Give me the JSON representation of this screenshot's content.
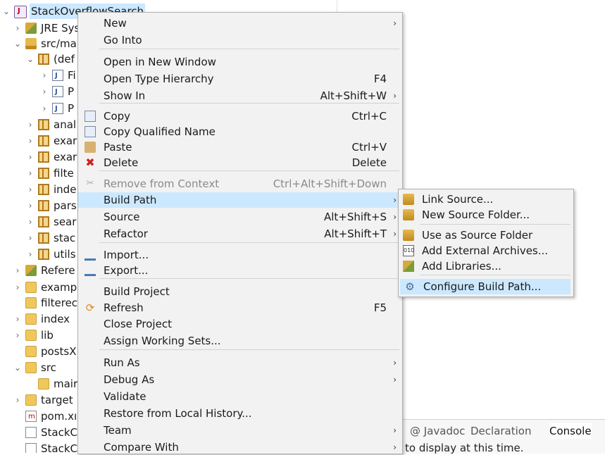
{
  "tree": {
    "items": [
      {
        "label": "StackOverflowSearch",
        "indent": 0,
        "chev": "⌄",
        "icon": "project",
        "selected": true
      },
      {
        "label": "JRE Sys",
        "indent": 1,
        "chev": "›",
        "icon": "library"
      },
      {
        "label": "src/ma",
        "indent": 1,
        "chev": "⌄",
        "icon": "source-folder"
      },
      {
        "label": "(def",
        "indent": 2,
        "chev": "⌄",
        "icon": "package"
      },
      {
        "label": "Fi",
        "indent": 3,
        "chev": "›",
        "icon": "java-file"
      },
      {
        "label": "P",
        "indent": 3,
        "chev": "›",
        "icon": "java-file"
      },
      {
        "label": "P",
        "indent": 3,
        "chev": "›",
        "icon": "java-file"
      },
      {
        "label": "anal",
        "indent": 2,
        "chev": "›",
        "icon": "package"
      },
      {
        "label": "exar",
        "indent": 2,
        "chev": "›",
        "icon": "package"
      },
      {
        "label": "exar",
        "indent": 2,
        "chev": "›",
        "icon": "package"
      },
      {
        "label": "filte",
        "indent": 2,
        "chev": "›",
        "icon": "package"
      },
      {
        "label": "inde",
        "indent": 2,
        "chev": "›",
        "icon": "package"
      },
      {
        "label": "pars",
        "indent": 2,
        "chev": "›",
        "icon": "package"
      },
      {
        "label": "sear",
        "indent": 2,
        "chev": "›",
        "icon": "package"
      },
      {
        "label": "stac",
        "indent": 2,
        "chev": "›",
        "icon": "package"
      },
      {
        "label": "utils",
        "indent": 2,
        "chev": "›",
        "icon": "package"
      },
      {
        "label": "Refere",
        "indent": 1,
        "chev": "›",
        "icon": "library"
      },
      {
        "label": "examp",
        "indent": 1,
        "chev": "›",
        "icon": "folder"
      },
      {
        "label": "filterec",
        "indent": 1,
        "chev": "",
        "icon": "folder"
      },
      {
        "label": "index",
        "indent": 1,
        "chev": "›",
        "icon": "folder"
      },
      {
        "label": "lib",
        "indent": 1,
        "chev": "›",
        "icon": "folder"
      },
      {
        "label": "postsX",
        "indent": 1,
        "chev": "",
        "icon": "folder"
      },
      {
        "label": "src",
        "indent": 1,
        "chev": "⌄",
        "icon": "folder"
      },
      {
        "label": "mair",
        "indent": 2,
        "chev": "",
        "icon": "folder"
      },
      {
        "label": "target",
        "indent": 1,
        "chev": "›",
        "icon": "folder"
      },
      {
        "label": "pom.xı",
        "indent": 1,
        "chev": "",
        "icon": "maven-file"
      },
      {
        "label": "StackC",
        "indent": 1,
        "chev": "",
        "icon": "file"
      },
      {
        "label": "StackC",
        "indent": 1,
        "chev": "",
        "icon": "file"
      }
    ]
  },
  "views": {
    "tabs": [
      {
        "label": "@ Javadoc",
        "active": false
      },
      {
        "label": "Declaration",
        "active": false
      },
      {
        "label": "Console",
        "active": true
      }
    ],
    "console_message": "to display at this time."
  },
  "context_menu": {
    "items": [
      {
        "type": "item",
        "label": "New",
        "submenu": true
      },
      {
        "type": "item",
        "label": "Go Into"
      },
      {
        "type": "sep"
      },
      {
        "type": "item",
        "label": "Open in New Window"
      },
      {
        "type": "item",
        "label": "Open Type Hierarchy",
        "accel": "F4"
      },
      {
        "type": "item",
        "label": "Show In",
        "accel": "Alt+Shift+W",
        "submenu": true
      },
      {
        "type": "sep"
      },
      {
        "type": "item",
        "label": "Copy",
        "accel": "Ctrl+C",
        "icon": "copy"
      },
      {
        "type": "item",
        "label": "Copy Qualified Name",
        "icon": "copy"
      },
      {
        "type": "item",
        "label": "Paste",
        "accel": "Ctrl+V",
        "icon": "paste"
      },
      {
        "type": "item",
        "label": "Delete",
        "accel": "Delete",
        "icon": "delete"
      },
      {
        "type": "sep"
      },
      {
        "type": "item",
        "label": "Remove from Context",
        "accel": "Ctrl+Alt+Shift+Down",
        "icon": "remove",
        "disabled": true
      },
      {
        "type": "item",
        "label": "Build Path",
        "submenu": true,
        "highlight": true
      },
      {
        "type": "item",
        "label": "Source",
        "accel": "Alt+Shift+S",
        "submenu": true
      },
      {
        "type": "item",
        "label": "Refactor",
        "accel": "Alt+Shift+T",
        "submenu": true
      },
      {
        "type": "sep"
      },
      {
        "type": "item",
        "label": "Import...",
        "icon": "import"
      },
      {
        "type": "item",
        "label": "Export...",
        "icon": "export"
      },
      {
        "type": "sep"
      },
      {
        "type": "item",
        "label": "Build Project"
      },
      {
        "type": "item",
        "label": "Refresh",
        "accel": "F5",
        "icon": "refresh"
      },
      {
        "type": "item",
        "label": "Close Project"
      },
      {
        "type": "item",
        "label": "Assign Working Sets..."
      },
      {
        "type": "sep"
      },
      {
        "type": "item",
        "label": "Run As",
        "submenu": true
      },
      {
        "type": "item",
        "label": "Debug As",
        "submenu": true
      },
      {
        "type": "item",
        "label": "Validate"
      },
      {
        "type": "item",
        "label": "Restore from Local History..."
      },
      {
        "type": "item",
        "label": "Team",
        "submenu": true
      },
      {
        "type": "item",
        "label": "Compare With",
        "submenu": true
      }
    ]
  },
  "build_path_submenu": {
    "items": [
      {
        "type": "item",
        "label": "Link Source...",
        "icon": "link-source"
      },
      {
        "type": "item",
        "label": "New Source Folder...",
        "icon": "new-source-folder"
      },
      {
        "type": "sep"
      },
      {
        "type": "item",
        "label": "Use as Source Folder",
        "icon": "use-source-folder"
      },
      {
        "type": "item",
        "label": "Add External Archives...",
        "icon": "jar"
      },
      {
        "type": "item",
        "label": "Add Libraries...",
        "icon": "libraries"
      },
      {
        "type": "sep"
      },
      {
        "type": "item",
        "label": "Configure Build Path...",
        "icon": "gear",
        "highlight": true
      }
    ]
  },
  "colors": {
    "menu_bg": "#f2f2f2",
    "highlight": "#cce8ff",
    "disabled_text": "#8a8a8a",
    "separator": "#d2d2d2"
  }
}
